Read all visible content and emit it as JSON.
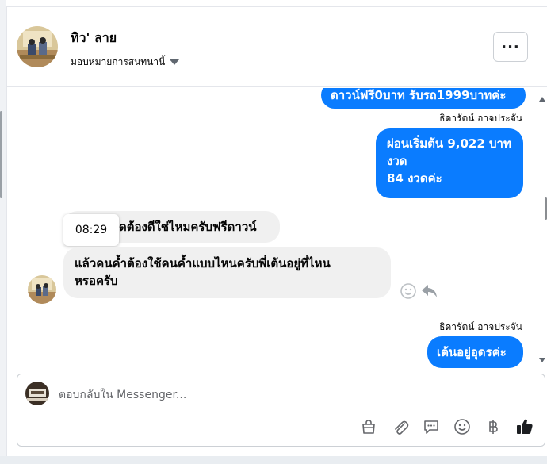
{
  "header": {
    "name": "ทิว' ลาย",
    "assign_label": "มอบหมายการสนทนานี้",
    "more_label": "···"
  },
  "thread": {
    "messages": [
      {
        "direction": "out",
        "text": "ดาวน์ฟรี0บาท รับรถ1999บาทค่ะ"
      },
      {
        "direction": "out",
        "sender": "ธิดารัตน์ อาจประจัน",
        "lines": [
          "ผ่อนเริ่มต้น 9,022 บาท",
          "งวด",
          "84 งวดค่ะ"
        ]
      },
      {
        "direction": "in",
        "text": "ดต้องดีใช่ไหมครับฟรีดาวน์"
      },
      {
        "direction": "in",
        "lines": [
          "แล้วคนค้ำต้องใช้คนค้ำแบบไหนครับพี่เต้นอยู่ที่ไหน",
          "หรอครับ"
        ]
      },
      {
        "direction": "out",
        "sender": "ธิดารัตน์ อาจประจัน",
        "text": "เต้นอยู่อุดรค่ะ"
      }
    ],
    "tooltip_time": "08:29"
  },
  "composer": {
    "placeholder": "ตอบกลับใน Messenger..."
  },
  "colors": {
    "accent": "#0a7cff",
    "incoming_bubble": "#f0f0f0",
    "border": "#ccd0d5"
  },
  "icons": {
    "toolbar": [
      "bag-icon",
      "paperclip-icon",
      "chat-template-icon",
      "emoji-icon",
      "baht-icon",
      "thumbs-up-icon"
    ],
    "message_actions": [
      "emoji-react-icon",
      "reply-icon"
    ]
  }
}
